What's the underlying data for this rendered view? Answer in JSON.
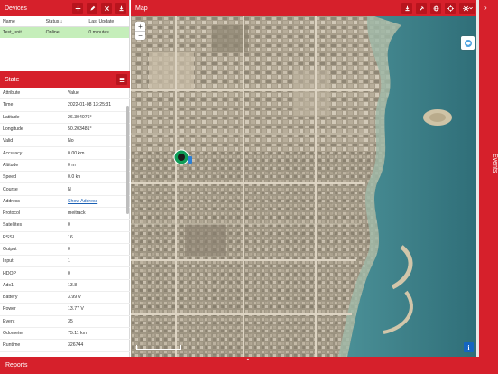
{
  "devices": {
    "title": "Devices",
    "columns": [
      "Name",
      "Status ↓",
      "Last Update"
    ],
    "rows": [
      {
        "name": "Test_unit",
        "status": "Online",
        "last_update": "0 minutes"
      }
    ],
    "toolbar_icons": [
      "add-icon",
      "edit-icon",
      "delete-icon",
      "download-icon"
    ]
  },
  "state": {
    "title": "State",
    "columns": [
      "Attribute",
      "Value"
    ],
    "rows": [
      [
        "Time",
        "2022-01-08 13:25:31"
      ],
      [
        "Latitude",
        "26.304076°"
      ],
      [
        "Longitude",
        "50.203481°"
      ],
      [
        "Valid",
        "No"
      ],
      [
        "Accuracy",
        "0.00 km"
      ],
      [
        "Altitude",
        "0 m"
      ],
      [
        "Speed",
        "0.0 kn"
      ],
      [
        "Course",
        "N"
      ],
      [
        "Address",
        "Show Address"
      ],
      [
        "Protocol",
        "meitrack"
      ],
      [
        "Satellites",
        "0"
      ],
      [
        "RSSI",
        "16"
      ],
      [
        "Output",
        "0"
      ],
      [
        "Input",
        "1"
      ],
      [
        "HDOP",
        "0"
      ],
      [
        "Adc1",
        "13.8"
      ],
      [
        "Battery",
        "3.99 V"
      ],
      [
        "Power",
        "13.77 V"
      ],
      [
        "Event",
        "35"
      ],
      [
        "Odometer",
        "75.11 km"
      ],
      [
        "Runtime",
        "326744"
      ]
    ]
  },
  "map": {
    "title": "Map",
    "zoom_in": "+",
    "zoom_out": "−",
    "info": "i",
    "toolbar_icons": [
      "download-icon",
      "pin-icon",
      "globe-icon",
      "target-icon",
      "settings-icon"
    ]
  },
  "events": {
    "title": "Events"
  },
  "reports": {
    "title": "Reports"
  },
  "colors": {
    "accent": "#d6202b",
    "selected_row": "#c5eeba",
    "link": "#1a5fb4"
  }
}
